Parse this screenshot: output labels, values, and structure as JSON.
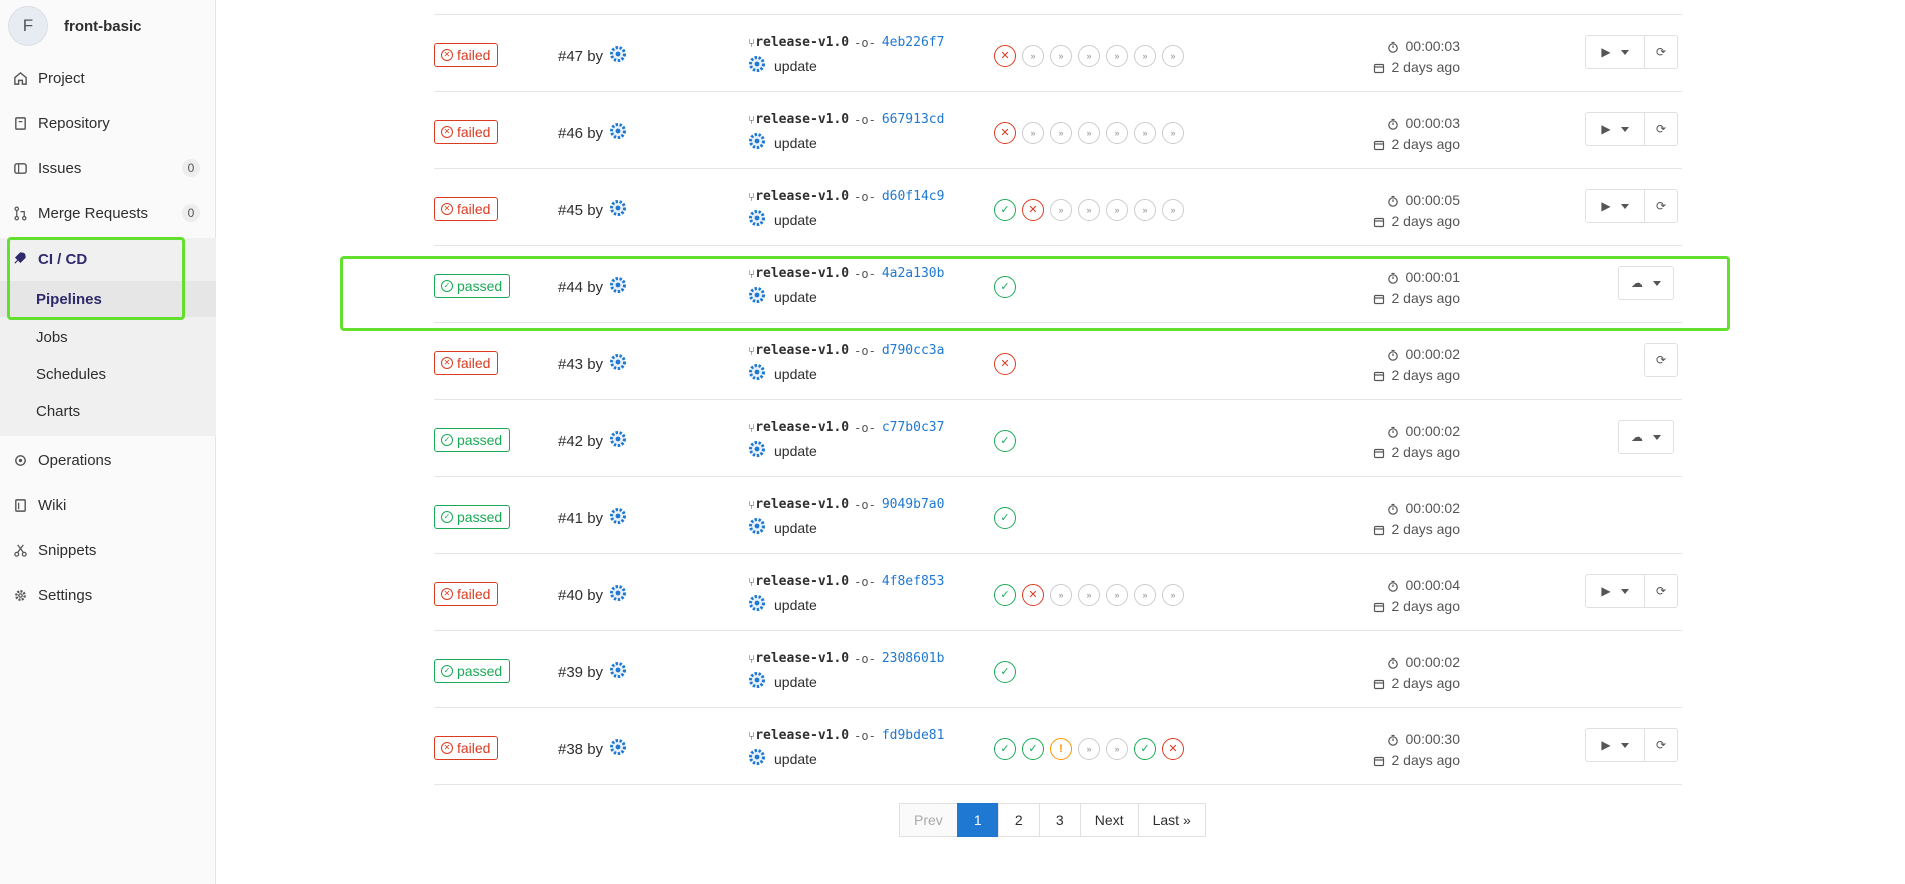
{
  "project": {
    "avatar_letter": "F",
    "name": "front-basic"
  },
  "nav": {
    "project": "Project",
    "repository": "Repository",
    "issues": "Issues",
    "issues_count": "0",
    "merge_requests": "Merge Requests",
    "merge_requests_count": "0",
    "cicd": "CI / CD",
    "pipelines": "Pipelines",
    "jobs": "Jobs",
    "schedules": "Schedules",
    "charts": "Charts",
    "operations": "Operations",
    "wiki": "Wiki",
    "snippets": "Snippets",
    "settings": "Settings"
  },
  "pipelines": [
    {
      "status": "failed",
      "id": "#47",
      "by": "by",
      "branch": "release-v1.0",
      "commit": "4eb226f7",
      "message": "update",
      "stages": [
        "failed",
        "skipped",
        "skipped",
        "skipped",
        "skipped",
        "skipped",
        "skipped"
      ],
      "duration": "00:00:03",
      "finished": "2 days ago",
      "actions": "play-retry"
    },
    {
      "status": "failed",
      "id": "#46",
      "by": "by",
      "branch": "release-v1.0",
      "commit": "667913cd",
      "message": "update",
      "stages": [
        "failed",
        "skipped",
        "skipped",
        "skipped",
        "skipped",
        "skipped",
        "skipped"
      ],
      "duration": "00:00:03",
      "finished": "2 days ago",
      "actions": "play-retry"
    },
    {
      "status": "failed",
      "id": "#45",
      "by": "by",
      "branch": "release-v1.0",
      "commit": "d60f14c9",
      "message": "update",
      "stages": [
        "success",
        "failed",
        "skipped",
        "skipped",
        "skipped",
        "skipped",
        "skipped"
      ],
      "duration": "00:00:05",
      "finished": "2 days ago",
      "actions": "play-retry"
    },
    {
      "status": "passed",
      "id": "#44",
      "by": "by",
      "branch": "release-v1.0",
      "commit": "4a2a130b",
      "message": "update",
      "stages": [
        "success"
      ],
      "duration": "00:00:01",
      "finished": "2 days ago",
      "actions": "download"
    },
    {
      "status": "failed",
      "id": "#43",
      "by": "by",
      "branch": "release-v1.0",
      "commit": "d790cc3a",
      "message": "update",
      "stages": [
        "failed"
      ],
      "duration": "00:00:02",
      "finished": "2 days ago",
      "actions": "retry"
    },
    {
      "status": "passed",
      "id": "#42",
      "by": "by",
      "branch": "release-v1.0",
      "commit": "c77b0c37",
      "message": "update",
      "stages": [
        "success"
      ],
      "duration": "00:00:02",
      "finished": "2 days ago",
      "actions": "download"
    },
    {
      "status": "passed",
      "id": "#41",
      "by": "by",
      "branch": "release-v1.0",
      "commit": "9049b7a0",
      "message": "update",
      "stages": [
        "success"
      ],
      "duration": "00:00:02",
      "finished": "2 days ago",
      "actions": "none"
    },
    {
      "status": "failed",
      "id": "#40",
      "by": "by",
      "branch": "release-v1.0",
      "commit": "4f8ef853",
      "message": "update",
      "stages": [
        "success",
        "failed",
        "skipped",
        "skipped",
        "skipped",
        "skipped",
        "skipped"
      ],
      "duration": "00:00:04",
      "finished": "2 days ago",
      "actions": "play-retry"
    },
    {
      "status": "passed",
      "id": "#39",
      "by": "by",
      "branch": "release-v1.0",
      "commit": "2308601b",
      "message": "update",
      "stages": [
        "success"
      ],
      "duration": "00:00:02",
      "finished": "2 days ago",
      "actions": "none"
    },
    {
      "status": "failed",
      "id": "#38",
      "by": "by",
      "branch": "release-v1.0",
      "commit": "fd9bde81",
      "message": "update",
      "stages": [
        "success",
        "success",
        "warning",
        "skipped",
        "skipped",
        "success",
        "failed"
      ],
      "duration": "00:00:30",
      "finished": "2 days ago",
      "actions": "play-retry"
    }
  ],
  "pagination": {
    "prev": "Prev",
    "pages": [
      "1",
      "2",
      "3"
    ],
    "current": "1",
    "next": "Next",
    "last": "Last »"
  },
  "colors": {
    "success": "#1aaa55",
    "failed": "#db3b21",
    "highlight": "#63e02d",
    "link": "#1f78d1"
  }
}
